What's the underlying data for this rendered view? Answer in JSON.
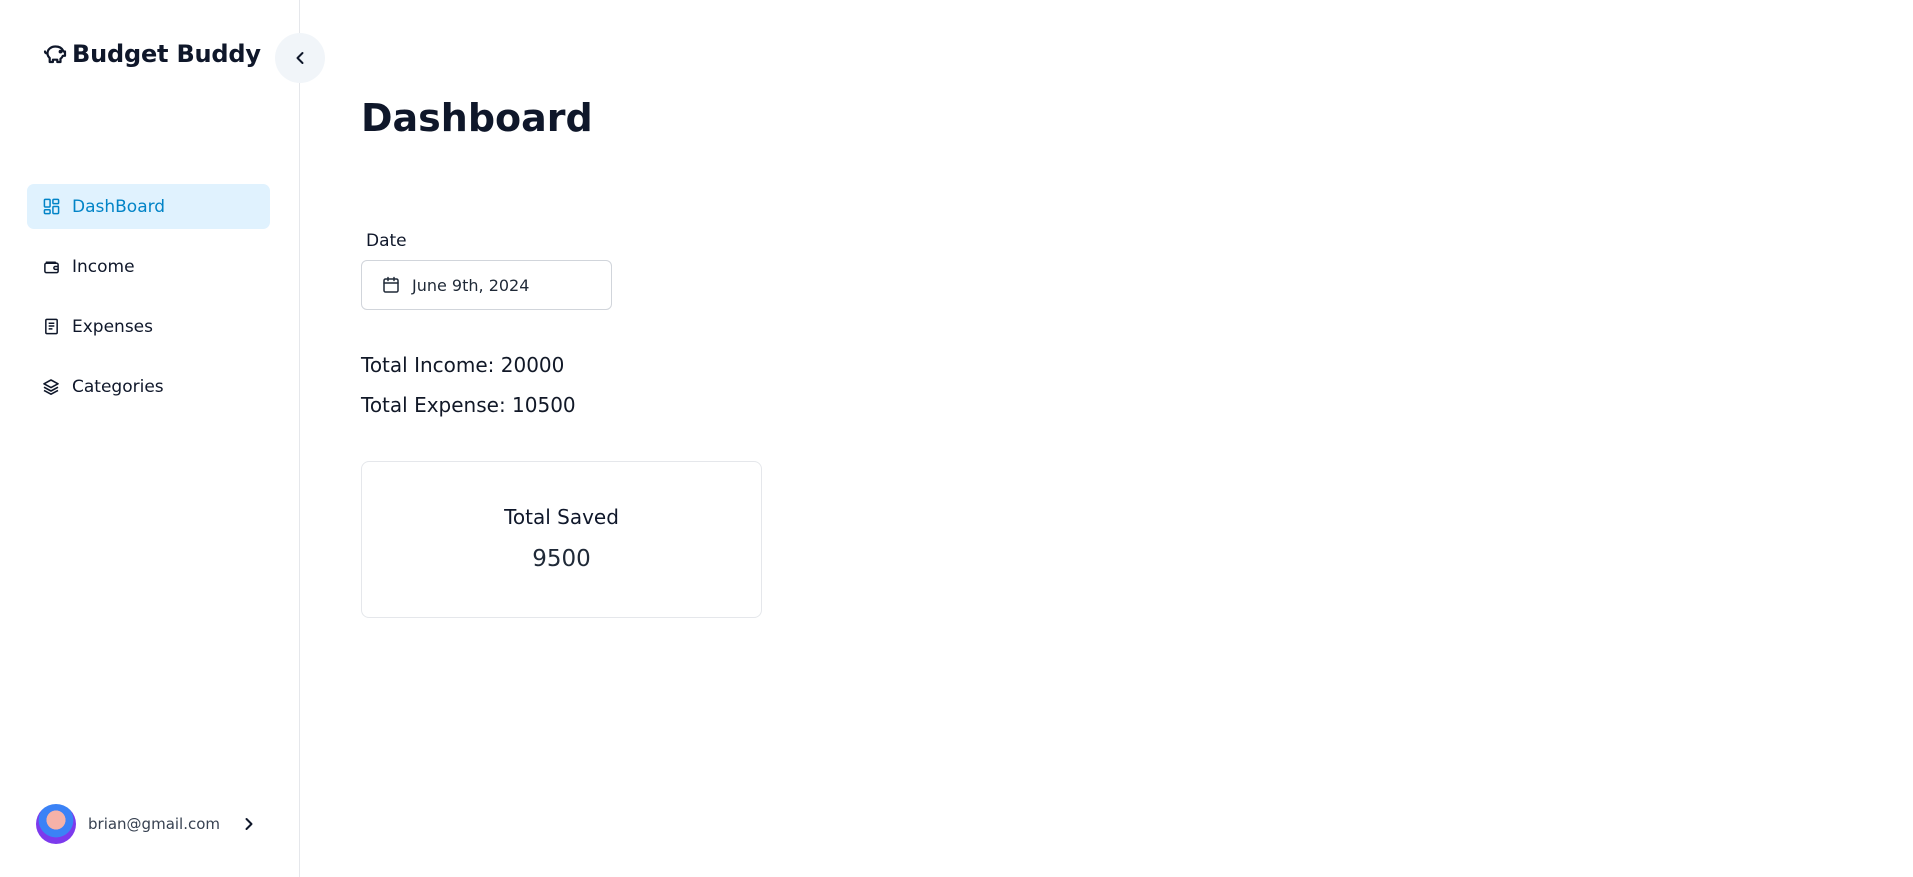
{
  "app": {
    "title": "Budget Buddy"
  },
  "sidebar": {
    "items": [
      {
        "label": "DashBoard",
        "icon": "dashboard-icon",
        "active": true
      },
      {
        "label": "Income",
        "icon": "wallet-icon",
        "active": false
      },
      {
        "label": "Expenses",
        "icon": "receipt-icon",
        "active": false
      },
      {
        "label": "Categories",
        "icon": "layers-icon",
        "active": false
      }
    ],
    "user": {
      "email": "brian@gmail.com"
    }
  },
  "main": {
    "title": "Dashboard",
    "date": {
      "label": "Date",
      "value": "June 9th, 2024"
    },
    "totals": {
      "income": "Total Income: 20000",
      "expense": "Total Expense: 10500"
    },
    "saved_card": {
      "title": "Total Saved",
      "value": "9500"
    }
  },
  "colors": {
    "accent": "#0284c7",
    "active_bg": "#e0f2fe",
    "text": "#0f172a",
    "border": "#e5e7eb"
  }
}
